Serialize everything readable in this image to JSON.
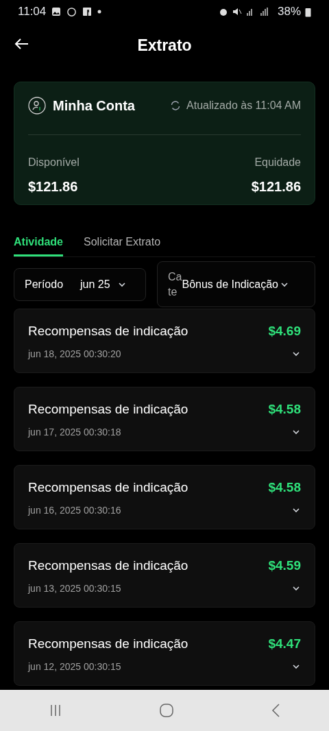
{
  "status_bar": {
    "time": "11:04",
    "battery": "38%"
  },
  "header": {
    "title": "Extrato"
  },
  "account": {
    "name": "Minha Conta",
    "updated": "Atualizado às 11:04 AM",
    "available_label": "Disponível",
    "available": "$121.86",
    "equity_label": "Equidade",
    "equity": "$121.86"
  },
  "tabs": [
    {
      "label": "Atividade",
      "selected": true
    },
    {
      "label": "Solicitar Extrato",
      "selected": false
    }
  ],
  "filters": {
    "period_label": "Período",
    "period_value": "jun 25",
    "category_label": "Ca te",
    "category_value": "Bônus de Indicação"
  },
  "transactions": [
    {
      "title": "Recompensas de indicação",
      "date": "jun 18, 2025 00:30:20",
      "amount": "$4.69"
    },
    {
      "title": "Recompensas de indicação",
      "date": "jun 17, 2025 00:30:18",
      "amount": "$4.58"
    },
    {
      "title": "Recompensas de indicação",
      "date": "jun 16, 2025 00:30:16",
      "amount": "$4.58"
    },
    {
      "title": "Recompensas de indicação",
      "date": "jun 13, 2025 00:30:15",
      "amount": "$4.59"
    },
    {
      "title": "Recompensas de indicação",
      "date": "jun 12, 2025 00:30:15",
      "amount": "$4.47"
    }
  ]
}
